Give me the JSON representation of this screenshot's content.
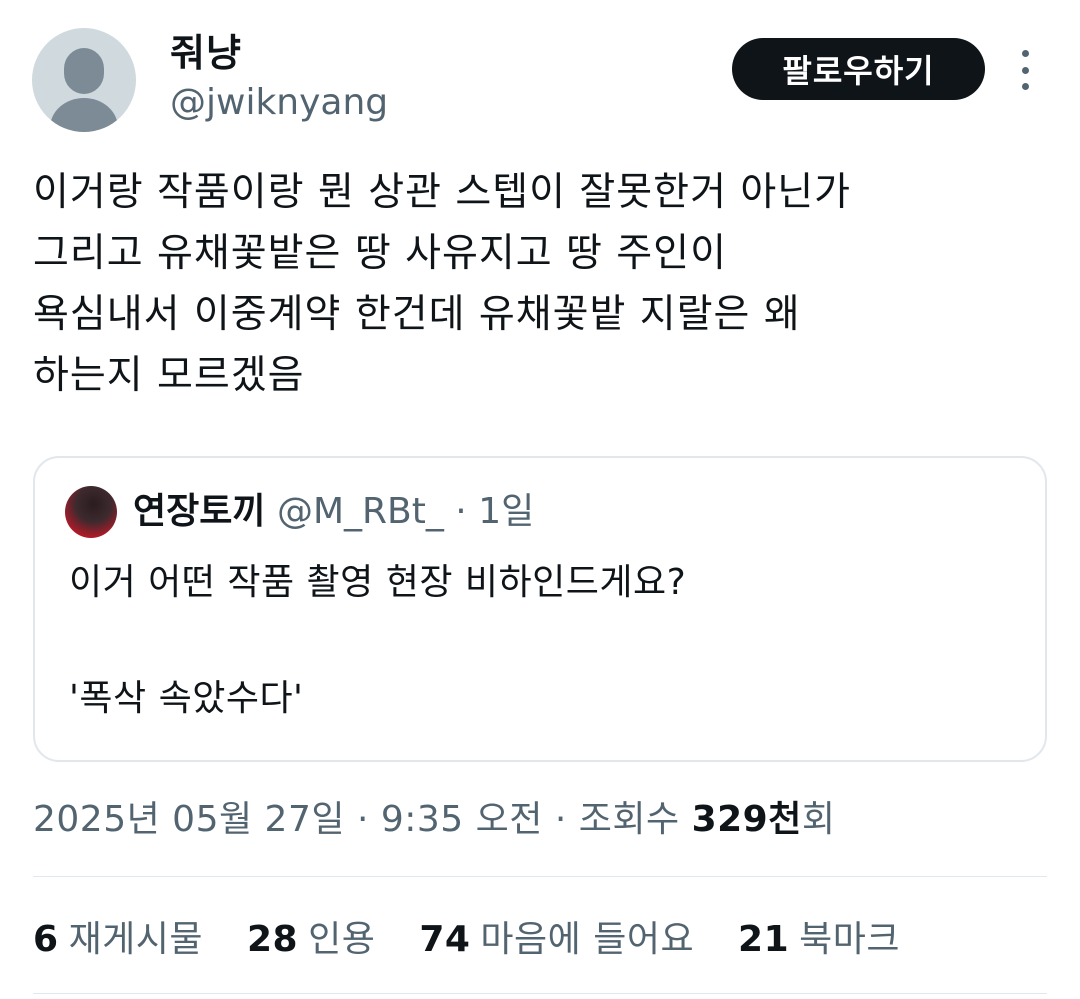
{
  "author": {
    "name": "줘냥",
    "handle": "@jwiknyang",
    "follow_label": "팔로우하기"
  },
  "tweet": {
    "text": "이거랑 작품이랑 뭔 상관 스텝이 잘못한거 아닌가\n그리고 유채꽃밭은 땅 사유지고 땅 주인이\n욕심내서 이중계약 한건데 유채꽃밭 지랄은 왜\n하는지 모르겠음"
  },
  "quote": {
    "name": "연장토끼",
    "handle": "@M_RBt_",
    "separator": "·",
    "time": "1일",
    "text": "이거 어떤 작품 촬영 현장 비하인드게요?\n\n'폭삭 속았수다'"
  },
  "meta": {
    "date": "2025년 05월 27일",
    "sep1": "·",
    "time": "9:35 오전",
    "sep2": "·",
    "views_label": "조회수",
    "views_num": "329천",
    "views_suffix": "회"
  },
  "stats": {
    "retweets_num": "6",
    "retweets_label": "재게시물",
    "quotes_num": "28",
    "quotes_label": "인용",
    "likes_num": "74",
    "likes_label": "마음에 들어요",
    "bookmarks_num": "21",
    "bookmarks_label": "북마크"
  },
  "colors": {
    "text": "#0f1419",
    "secondary": "#536471",
    "border": "#e1e7eb",
    "button_bg": "#0f1419"
  }
}
